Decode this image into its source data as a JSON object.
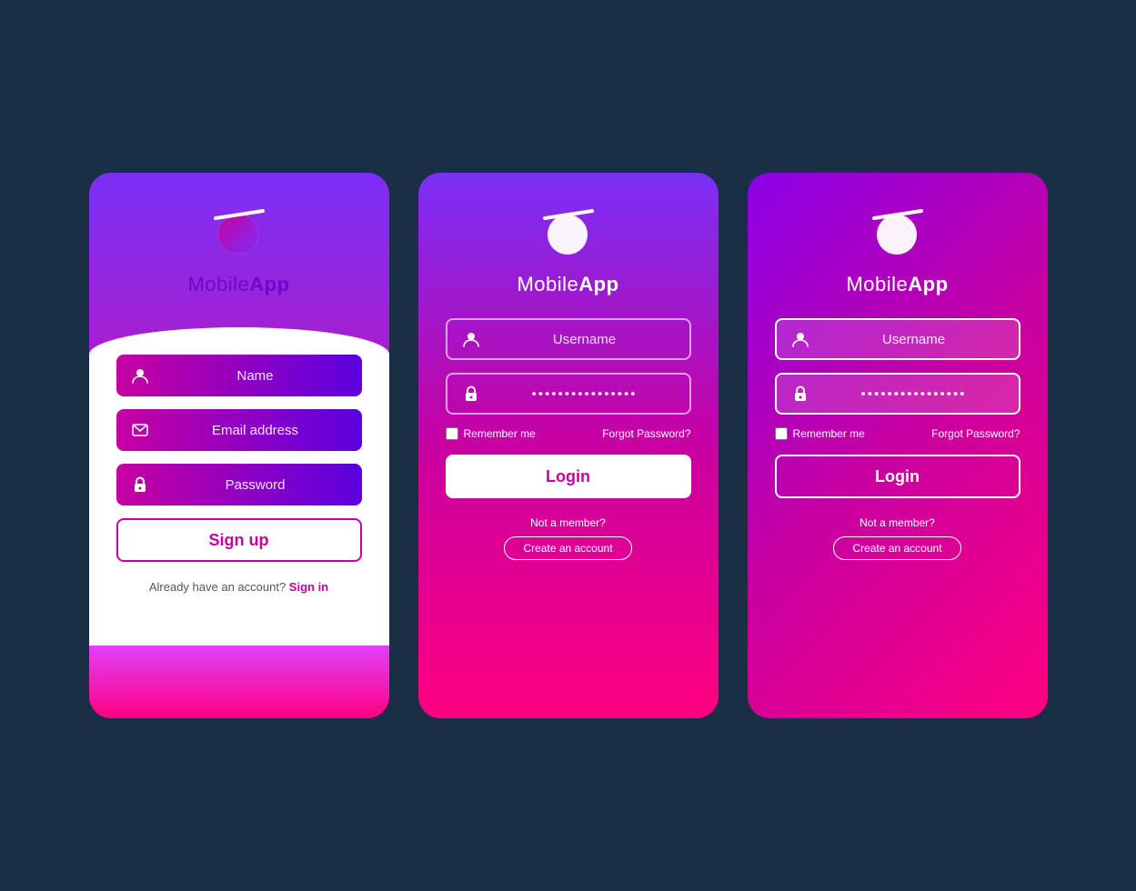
{
  "cards": [
    {
      "id": "card-1",
      "type": "signup",
      "app_name_light": "Mobile",
      "app_name_bold": "App",
      "fields": [
        {
          "placeholder": "Name",
          "type": "text",
          "icon": "user"
        },
        {
          "placeholder": "Email address",
          "type": "email",
          "icon": "email"
        },
        {
          "placeholder": "Password",
          "type": "password",
          "icon": "lock"
        }
      ],
      "signup_button": "Sign up",
      "footer_text": "Already have an account?",
      "footer_link": "Sign in"
    },
    {
      "id": "card-2",
      "type": "login",
      "app_name_light": "Mobile",
      "app_name_bold": "App",
      "fields": [
        {
          "placeholder": "Username",
          "type": "text",
          "icon": "user"
        },
        {
          "placeholder": "••••••••••••••••",
          "type": "password",
          "icon": "lock"
        }
      ],
      "remember_me": "Remember me",
      "forgot_password": "Forgot Password?",
      "login_button": "Login",
      "not_member": "Not a member?",
      "create_account": "Create an account"
    },
    {
      "id": "card-3",
      "type": "login",
      "app_name_light": "Mobile",
      "app_name_bold": "App",
      "fields": [
        {
          "placeholder": "Username",
          "type": "text",
          "icon": "user"
        },
        {
          "placeholder": "••••••••••••••••",
          "type": "password",
          "icon": "lock"
        }
      ],
      "remember_me": "Remember me",
      "forgot_password": "Forgot Password?",
      "login_button": "Login",
      "not_member": "Not a member?",
      "create_account": "Create an account"
    }
  ]
}
